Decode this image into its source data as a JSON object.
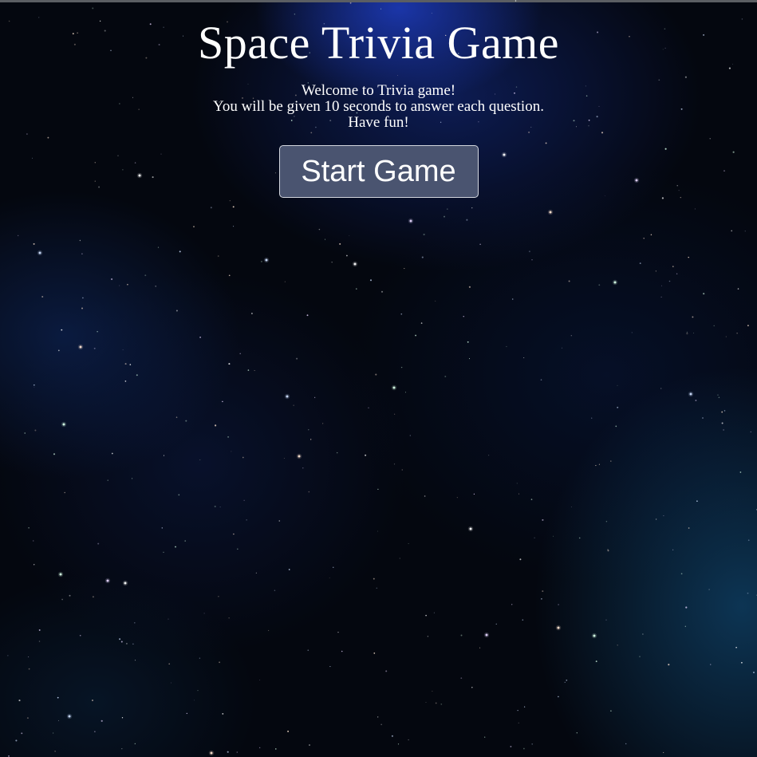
{
  "page": {
    "title": "Space Trivia Game",
    "intro_lines": [
      "Welcome to Trivia game!",
      "You will be given 10 seconds to answer each question.",
      "Have fun!"
    ],
    "start_button_label": "Start Game"
  },
  "colors": {
    "background": "#04070f",
    "nebula_blue": "#1e3cbe",
    "button_fill": "#4a5470",
    "button_border": "#d3d6de",
    "text": "#ffffff"
  }
}
